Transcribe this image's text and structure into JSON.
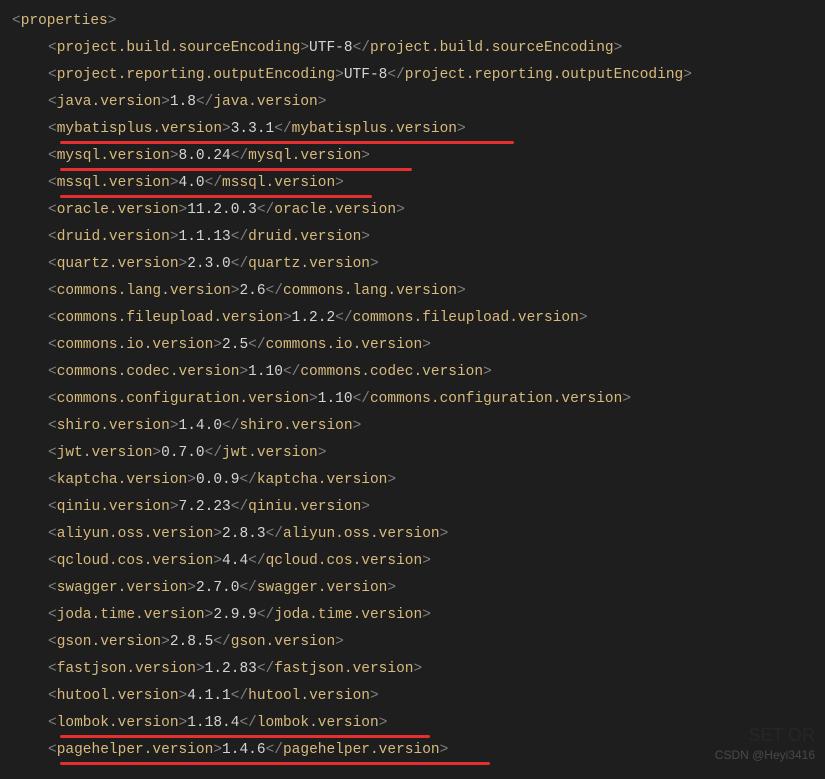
{
  "root_tag": "properties",
  "properties": [
    {
      "key": "project.build.sourceEncoding",
      "value": "UTF-8",
      "underline": false
    },
    {
      "key": "project.reporting.outputEncoding",
      "value": "UTF-8",
      "underline": false
    },
    {
      "key": "java.version",
      "value": "1.8",
      "underline": false
    },
    {
      "key": "mybatisplus.version",
      "value": "3.3.1",
      "underline": true,
      "u_start": 48,
      "u_end": 502
    },
    {
      "key": "mysql.version",
      "value": "8.0.24",
      "underline": true,
      "u_start": 48,
      "u_end": 400
    },
    {
      "key": "mssql.version",
      "value": "4.0",
      "underline": true,
      "u_start": 48,
      "u_end": 360
    },
    {
      "key": "oracle.version",
      "value": "11.2.0.3",
      "underline": false
    },
    {
      "key": "druid.version",
      "value": "1.1.13",
      "underline": false
    },
    {
      "key": "quartz.version",
      "value": "2.3.0",
      "underline": false
    },
    {
      "key": "commons.lang.version",
      "value": "2.6",
      "underline": false
    },
    {
      "key": "commons.fileupload.version",
      "value": "1.2.2",
      "underline": false
    },
    {
      "key": "commons.io.version",
      "value": "2.5",
      "underline": false
    },
    {
      "key": "commons.codec.version",
      "value": "1.10",
      "underline": false
    },
    {
      "key": "commons.configuration.version",
      "value": "1.10",
      "underline": false
    },
    {
      "key": "shiro.version",
      "value": "1.4.0",
      "underline": false
    },
    {
      "key": "jwt.version",
      "value": "0.7.0",
      "underline": false
    },
    {
      "key": "kaptcha.version",
      "value": "0.0.9",
      "underline": false
    },
    {
      "key": "qiniu.version",
      "value": "7.2.23",
      "underline": false
    },
    {
      "key": "aliyun.oss.version",
      "value": "2.8.3",
      "underline": false
    },
    {
      "key": "qcloud.cos.version",
      "value": "4.4",
      "underline": false
    },
    {
      "key": "swagger.version",
      "value": "2.7.0",
      "underline": false
    },
    {
      "key": "joda.time.version",
      "value": "2.9.9",
      "underline": false
    },
    {
      "key": "gson.version",
      "value": "2.8.5",
      "underline": false
    },
    {
      "key": "fastjson.version",
      "value": "1.2.83",
      "underline": false
    },
    {
      "key": "hutool.version",
      "value": "4.1.1",
      "underline": false
    },
    {
      "key": "lombok.version",
      "value": "1.18.4",
      "underline": true,
      "u_start": 48,
      "u_end": 418
    },
    {
      "key": "pagehelper.version",
      "value": "1.4.6",
      "underline": true,
      "u_start": 48,
      "u_end": 478
    }
  ],
  "watermark": "CSDN @Heyi3416",
  "watermark_bg": "SET OR"
}
